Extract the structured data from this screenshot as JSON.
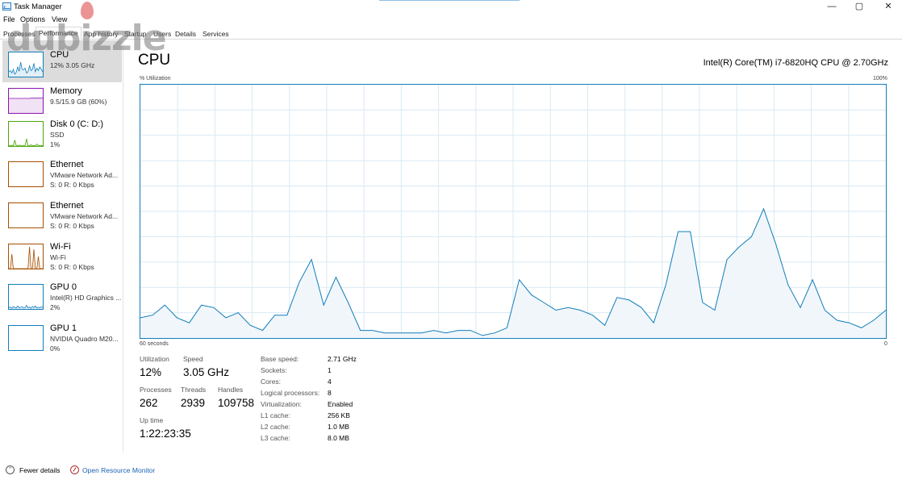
{
  "window": {
    "title": "Task Manager",
    "controls": {
      "minimize": "—",
      "maximize": "▢",
      "close": "✕"
    }
  },
  "menu": [
    "File",
    "Options",
    "View"
  ],
  "tabs": [
    "Processes",
    "Performance",
    "App history",
    "Startup",
    "Users",
    "Details",
    "Services"
  ],
  "active_tab": "Performance",
  "watermark": "dubizzle",
  "sidebar": {
    "items": [
      {
        "title": "CPU",
        "line1": "12% 3.05 GHz",
        "line2": "",
        "color": "#117dbb",
        "graph": [
          20,
          25,
          15,
          30,
          10,
          18,
          40,
          22,
          60,
          30,
          28,
          35,
          15,
          20,
          45,
          25,
          30,
          55,
          20,
          35,
          25,
          40,
          30,
          20
        ]
      },
      {
        "title": "Memory",
        "line1": "9.5/15.9 GB (60%)",
        "line2": "",
        "color": "#8b12ae",
        "graph": [
          60,
          60,
          60,
          60,
          60,
          60,
          60,
          60,
          60,
          60,
          60,
          60,
          60,
          60,
          60,
          61,
          61,
          61,
          61,
          61,
          61,
          61,
          61,
          62
        ]
      },
      {
        "title": "Disk 0 (C: D:)",
        "line1": "SSD",
        "line2": "1%",
        "color": "#4da60c",
        "graph": [
          2,
          1,
          3,
          1,
          25,
          2,
          1,
          4,
          2,
          1,
          3,
          2,
          30,
          1,
          2,
          5,
          1,
          2,
          1,
          8,
          2,
          1,
          3,
          1
        ]
      },
      {
        "title": "Ethernet",
        "line1": "VMware Network Ad...",
        "line2": "S: 0 R: 0 Kbps",
        "color": "#a74f01",
        "graph": []
      },
      {
        "title": "Ethernet",
        "line1": "VMware Network Ad...",
        "line2": "S: 0 R: 0 Kbps",
        "color": "#a74f01",
        "graph": []
      },
      {
        "title": "Wi-Fi",
        "line1": "Wi-Fi",
        "line2": "S: 0 R: 0 Kbps",
        "color": "#a74f01",
        "graph": [
          0,
          0,
          60,
          0,
          0,
          0,
          0,
          0,
          0,
          0,
          0,
          0,
          0,
          0,
          90,
          0,
          0,
          80,
          0,
          0,
          50,
          0,
          0,
          0
        ]
      },
      {
        "title": "GPU 0",
        "line1": "Intel(R) HD Graphics ...",
        "line2": "2%",
        "color": "#117dbb",
        "graph": [
          5,
          8,
          3,
          10,
          6,
          4,
          12,
          5,
          7,
          9,
          4,
          6,
          15,
          5,
          8,
          3,
          10,
          6,
          12,
          4,
          7,
          5,
          9,
          6
        ]
      },
      {
        "title": "GPU 1",
        "line1": "NVIDIA Quadro M20...",
        "line2": "0%",
        "color": "#117dbb",
        "graph": []
      }
    ]
  },
  "main": {
    "title": "CPU",
    "cpu_model": "Intel(R) Core(TM) i7-6820HQ CPU @ 2.70GHz",
    "utilization_label": "% Utilization",
    "max_label": "100%",
    "time_label": "60 seconds",
    "min_label": "0",
    "graph_color": "#117dbb",
    "graph_fill": "#f1f6fa",
    "grid_color": "#d9eaf4",
    "utilization_history": [
      8,
      9,
      13,
      8,
      6,
      13,
      12,
      8,
      10,
      5,
      3,
      9,
      9,
      22,
      31,
      13,
      24,
      14,
      3,
      3,
      2,
      2,
      2,
      2,
      3,
      2,
      3,
      3,
      1,
      2,
      4,
      23,
      17,
      14,
      11,
      12,
      11,
      9,
      5,
      16,
      15,
      12,
      6,
      21,
      42,
      42,
      14,
      11,
      31,
      36,
      40,
      51,
      37,
      21,
      12,
      23,
      11,
      7,
      6,
      4,
      7,
      11
    ],
    "stats": {
      "utilization": {
        "label": "Utilization",
        "value": "12%"
      },
      "speed": {
        "label": "Speed",
        "value": "3.05 GHz"
      },
      "processes": {
        "label": "Processes",
        "value": "262"
      },
      "threads": {
        "label": "Threads",
        "value": "2939"
      },
      "handles": {
        "label": "Handles",
        "value": "109758"
      },
      "uptime": {
        "label": "Up time",
        "value": "1:22:23:35"
      }
    },
    "info": [
      {
        "label": "Base speed:",
        "value": "2.71 GHz"
      },
      {
        "label": "Sockets:",
        "value": "1"
      },
      {
        "label": "Cores:",
        "value": "4"
      },
      {
        "label": "Logical processors:",
        "value": "8"
      },
      {
        "label": "Virtualization:",
        "value": "Enabled"
      },
      {
        "label": "L1 cache:",
        "value": "256 KB"
      },
      {
        "label": "L2 cache:",
        "value": "1.0 MB"
      },
      {
        "label": "L3 cache:",
        "value": "8.0 MB"
      }
    ]
  },
  "footer": {
    "fewer_details": "Fewer details",
    "open_resource_monitor": "Open Resource Monitor"
  }
}
